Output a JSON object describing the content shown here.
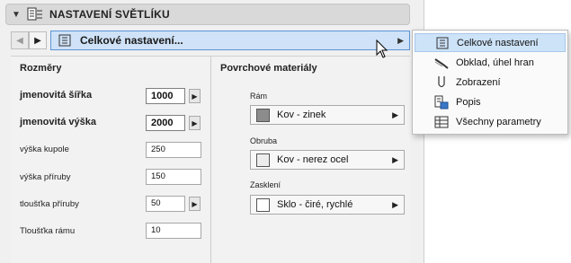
{
  "header": {
    "title": "NASTAVENÍ SVĚTLÍKU",
    "collapse_glyph": "▼"
  },
  "nav": {
    "back_glyph": "◀",
    "forward_glyph": "▶",
    "current_page": "Celkové nastavení...",
    "arrow_glyph": "▶"
  },
  "dimensions": {
    "title": "Rozměry",
    "rows": [
      {
        "label": "jmenovitá šířka",
        "value": "1000",
        "bold": true,
        "spinner": "▶"
      },
      {
        "label": "jmenovitá výška",
        "value": "2000",
        "bold": true,
        "spinner": "▶"
      },
      {
        "label": "výška kupole",
        "value": "250"
      },
      {
        "label": "výška příruby",
        "value": "150"
      },
      {
        "label": "tloušťka příruby",
        "value": "50",
        "spinner": "▶"
      },
      {
        "label": "Tloušťka rámu",
        "value": "10"
      }
    ]
  },
  "materials": {
    "title": "Povrchové materiály",
    "items": [
      {
        "label": "Rám",
        "value": "Kov - zinek",
        "swatch": "#8c8c8c"
      },
      {
        "label": "Obruba",
        "value": "Kov - nerez ocel",
        "swatch": "#ededed"
      },
      {
        "label": "Zasklení",
        "value": "Sklo - čiré, rychlé",
        "swatch": "#ffffff"
      }
    ],
    "arrow_glyph": "▶"
  },
  "menu": {
    "items": [
      {
        "label": "Celkové nastavení",
        "icon": "settings-page-icon",
        "selected": true
      },
      {
        "label": "Obklad, úhel hran",
        "icon": "cladding-icon"
      },
      {
        "label": "Zobrazení",
        "icon": "display-icon"
      },
      {
        "label": "Popis",
        "icon": "description-icon"
      },
      {
        "label": "Všechny parametry",
        "icon": "all-parameters-icon"
      }
    ]
  },
  "colors": {
    "accent": "#5b95d6",
    "selection": "#cde3f8"
  }
}
